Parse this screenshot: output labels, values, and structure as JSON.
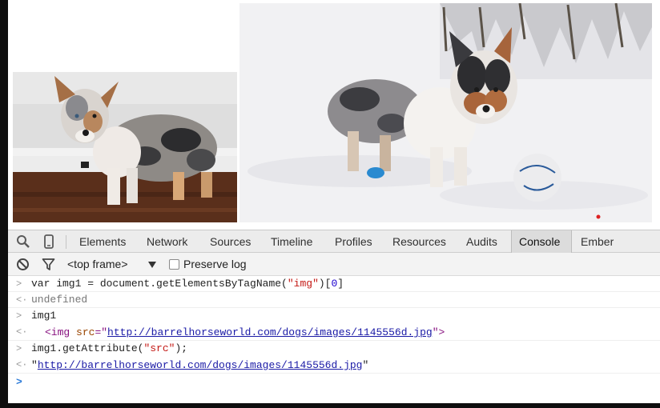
{
  "devtools": {
    "tabs": [
      "Elements",
      "Network",
      "Sources",
      "Timeline",
      "Profiles",
      "Resources",
      "Audits",
      "Console",
      "Ember"
    ],
    "active_tab": "Console",
    "frame_selector": "<top frame>",
    "preserve_log": "Preserve log"
  },
  "console": {
    "l1_prefix": "var img1 = document.getElementsByTagName(",
    "l1_str": "\"img\"",
    "l1_mid": ")[",
    "l1_num": "0",
    "l1_end": "]",
    "l2": "undefined",
    "l3": "img1",
    "l4_open": "<img",
    "l4_attr": "src",
    "l4_eq": "=\"",
    "l4_url": "http://barrelhorseworld.com/dogs/images/1145556d.jpg",
    "l4_close": "\">",
    "l5_prefix": "img1.getAttribute(",
    "l5_str": "\"src\"",
    "l5_end": ");",
    "l6_q1": "\"",
    "l6_url": "http://barrelhorseworld.com/dogs/images/1145556d.jpg",
    "l6_q2": "\""
  },
  "colors": {
    "string": "#c41a16",
    "number": "#1c00cf",
    "tag": "#881280",
    "attribute": "#994500",
    "link": "#1a1aa6",
    "prompt": "#2d7bd8"
  },
  "icons": [
    "inspect-icon",
    "device-mode-icon",
    "clear-console-icon",
    "filter-icon",
    "dropdown-arrow-icon"
  ]
}
